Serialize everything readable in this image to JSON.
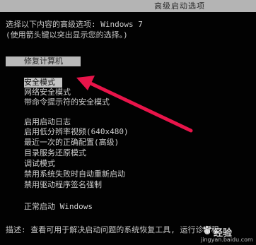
{
  "title": "高级启动选项",
  "intro": {
    "line1": "选择以下内容的高级选项: Windows 7",
    "line2": "(使用箭头键以突出显示您的选择。)"
  },
  "repair_label": "修复计算机",
  "options": [
    "安全模式",
    "网络安全模式",
    "带命令提示符的安全模式",
    "启用启动日志",
    "启用低分辨率视频(640x480)",
    "最近一次的正确配置(高级)",
    "目录服务还原模式",
    "调试模式",
    "禁用系统失败时自动重新启动",
    "禁用驱动程序签名强制",
    "正常启动 Windows"
  ],
  "description": "描述: 查看可用于解决启动问题的系统恢复工具, 运行诊断程",
  "watermark": {
    "brand": "经验",
    "url": "jingyan.baidu.com"
  },
  "colors": {
    "background": "#020202",
    "text": "#c8c8c8",
    "highlight": "#c4c4c4",
    "arrow": "#e8144a"
  }
}
